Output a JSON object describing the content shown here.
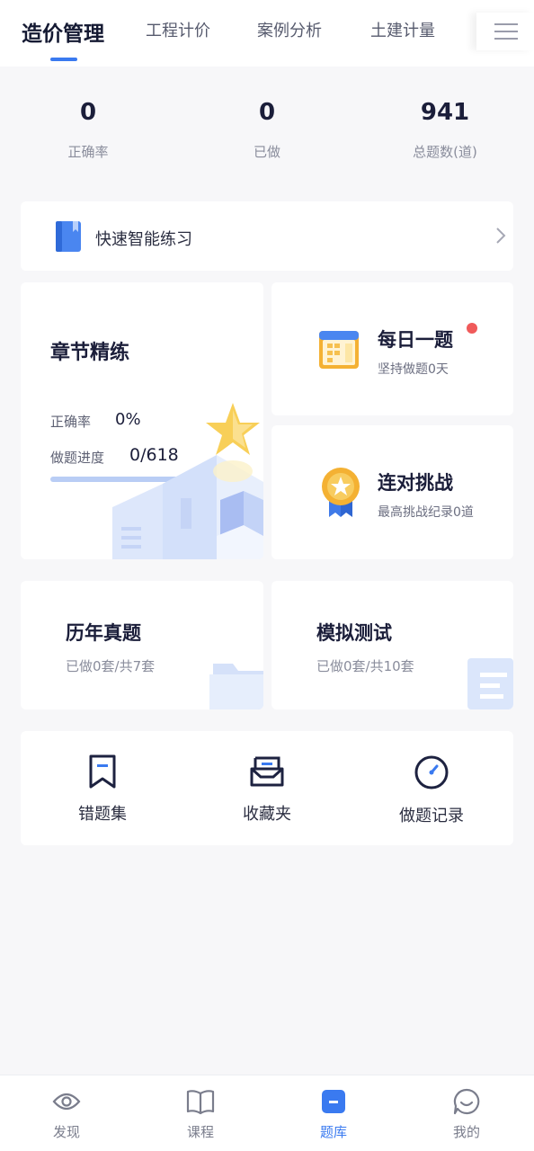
{
  "tabs": [
    {
      "label": "造价管理",
      "active": true
    },
    {
      "label": "工程计价",
      "active": false
    },
    {
      "label": "案例分析",
      "active": false
    },
    {
      "label": "土建计量",
      "active": false
    }
  ],
  "menu_icon": "hamburger-menu-icon",
  "stats": [
    {
      "value": "0",
      "label": "正确率"
    },
    {
      "value": "0",
      "label": "已做"
    },
    {
      "value": "941",
      "label": "总题数(道)"
    }
  ],
  "quick_practice": {
    "label": "快速智能练习",
    "icon": "book-icon"
  },
  "chapter": {
    "title": "章节精练",
    "rate_label": "正确率",
    "rate_value": "0%",
    "progress_label": "做题进度",
    "progress_value": "0/618",
    "progress_fraction": 0
  },
  "daily": {
    "title": "每日一题",
    "subtitle": "坚持做题0天",
    "has_notification": true,
    "icon": "calendar-icon"
  },
  "challenge": {
    "title": "连对挑战",
    "subtitle": "最高挑战纪录0道",
    "icon": "medal-icon"
  },
  "past_exams": {
    "title": "历年真题",
    "subtitle": "已做0套/共7套"
  },
  "mock_test": {
    "title": "模拟测试",
    "subtitle": "已做0套/共10套"
  },
  "tools": [
    {
      "label": "错题集",
      "icon": "bookmark-icon"
    },
    {
      "label": "收藏夹",
      "icon": "inbox-icon"
    },
    {
      "label": "做题记录",
      "icon": "clock-icon"
    }
  ],
  "bottom_nav": [
    {
      "label": "发现",
      "icon": "eye-icon",
      "active": false
    },
    {
      "label": "课程",
      "icon": "open-book-icon",
      "active": false
    },
    {
      "label": "题库",
      "icon": "question-bank-icon",
      "active": true
    },
    {
      "label": "我的",
      "icon": "smile-icon",
      "active": false
    }
  ],
  "colors": {
    "accent": "#3a7af0",
    "notification": "#f05a5a",
    "background": "#f7f7f9"
  }
}
